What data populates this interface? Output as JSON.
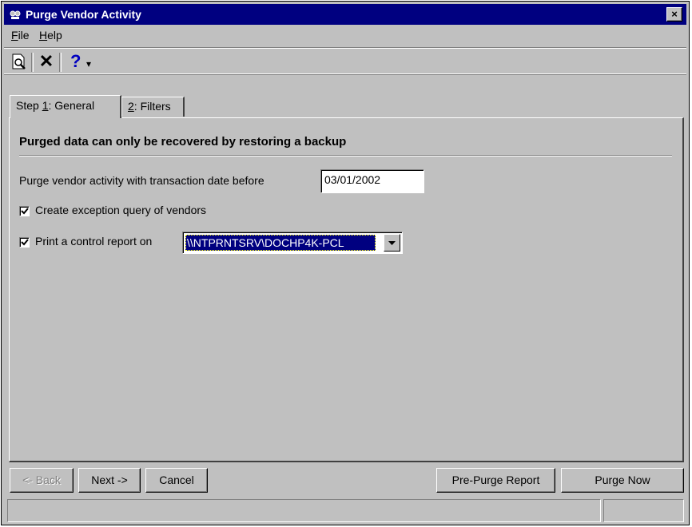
{
  "window": {
    "title": "Purge Vendor Activity",
    "close_glyph": "×"
  },
  "menu": [
    {
      "label": "File",
      "accel": "F",
      "rest": "ile"
    },
    {
      "label": "Help",
      "accel": "H",
      "rest": "elp"
    }
  ],
  "toolbar": {
    "preview_icon": "print-preview-icon",
    "close_glyph": "✕",
    "help_glyph": "?",
    "help_dropdown_glyph": "▾"
  },
  "tabs": [
    {
      "label": "Step 1: General",
      "pre": "Step ",
      "accel": "1",
      "rest": ": General",
      "active": true
    },
    {
      "label": "2: Filters",
      "pre": "",
      "accel": "2",
      "rest": ": Filters",
      "active": false
    }
  ],
  "general": {
    "heading": "Purged data can only be recovered by restoring a backup",
    "date_label": "Purge vendor activity with transaction date before",
    "date_value": "03/01/2002",
    "exception_checkbox": {
      "label": "Create exception query of vendors",
      "checked": true
    },
    "report_checkbox": {
      "label": "Print a control report on",
      "checked": true
    },
    "printer_value": "\\\\NTPRNTSRV\\DOCHP4K-PCL"
  },
  "buttons": {
    "back": {
      "label": "<- Back",
      "accel": "B",
      "enabled": false
    },
    "next": {
      "label": "Next ->",
      "accel": "N",
      "enabled": true
    },
    "cancel": {
      "label": "Cancel",
      "enabled": true
    },
    "pre_purge": {
      "label": "Pre-Purge Report",
      "accel": "R",
      "enabled": true
    },
    "purge_now": {
      "label": "Purge Now",
      "accel": "P",
      "enabled": true
    }
  },
  "colors": {
    "title_bar": "#000080",
    "face": "#c0c0c0",
    "selection": "#000080",
    "help_icon": "#0000c0"
  }
}
